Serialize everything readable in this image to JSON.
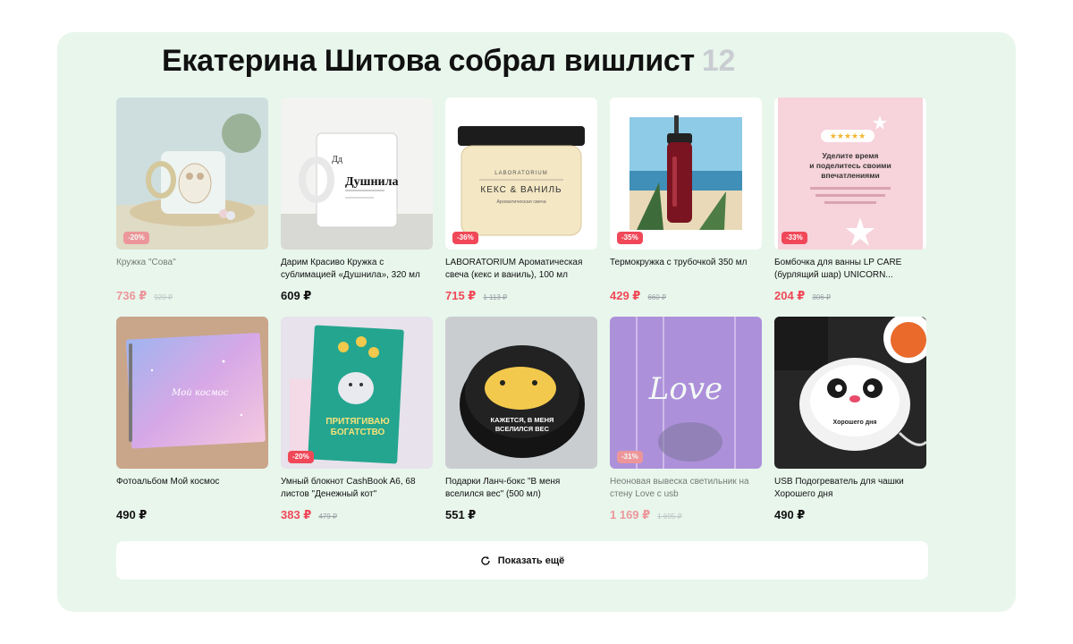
{
  "wishlist": {
    "title": "Екатерина Шитова собрал вишлист",
    "count": "12",
    "show_more_label": "Показать ещё",
    "items": [
      {
        "name": "Кружка \"Сова\"",
        "price": "736 ₽",
        "old_price": "920 ₽",
        "discount": "-20%",
        "sale": true,
        "faded": true
      },
      {
        "name": "Дарим Красиво Кружка с сублимацией «Душнила», 320 мл",
        "price": "609 ₽",
        "old_price": "",
        "discount": "",
        "sale": false,
        "faded": false
      },
      {
        "name": "LABORATORIUM Ароматическая свеча (кекс и ваниль), 100 мл",
        "price": "715 ₽",
        "old_price": "1 113 ₽",
        "discount": "-36%",
        "sale": true,
        "faded": false
      },
      {
        "name": "Термокружка с трубочкой 350 мл",
        "price": "429 ₽",
        "old_price": "660 ₽",
        "discount": "-35%",
        "sale": true,
        "faded": false
      },
      {
        "name": "Бомбочка для ванны LP CARE (бурлящий шар) UNICORN...",
        "price": "204 ₽",
        "old_price": "306 ₽",
        "discount": "-33%",
        "sale": true,
        "faded": false
      },
      {
        "name": "Фотоальбом Мой космос",
        "price": "490 ₽",
        "old_price": "",
        "discount": "",
        "sale": false,
        "faded": false
      },
      {
        "name": "Умный блокнот CashBook A6, 68 листов \"Денежный кот\"",
        "price": "383 ₽",
        "old_price": "479 ₽",
        "discount": "-20%",
        "sale": true,
        "faded": false
      },
      {
        "name": "Подарки Ланч-бокс \"В меня вселился вес\" (500 мл)",
        "price": "551 ₽",
        "old_price": "",
        "discount": "",
        "sale": false,
        "faded": false
      },
      {
        "name": "Неоновая вывеска светильник на стену Love с usb",
        "price": "1 169 ₽",
        "old_price": "1 695 ₽",
        "discount": "-31%",
        "sale": true,
        "faded": true
      },
      {
        "name": "USB Подогреватель для чашки Хорошего дня",
        "price": "490 ₽",
        "old_price": "",
        "discount": "",
        "sale": false,
        "faded": false
      }
    ],
    "image_text": {
      "mug2_word": "Душнила",
      "mug2_prefix": "Дд",
      "candle_brand": "LABORATORIUM",
      "candle_scent": "КЕКС & ВАНИЛЬ",
      "candle_sub": "Ароматическая свеча",
      "promo_line1": "Уделите время",
      "promo_line2": "и поделитесь своими",
      "promo_line3": "впечатлениями",
      "album_text": "Мой космос",
      "notebook_line1": "ПРИТЯГИВАЮ",
      "notebook_line2": "БОГАТСТВО",
      "lunch_line1": "КАЖЕТСЯ, В МЕНЯ",
      "lunch_line2": "ВСЕЛИЛСЯ ВЕС",
      "neon_text": "Love",
      "warmer_text": "Хорошего дня"
    }
  }
}
